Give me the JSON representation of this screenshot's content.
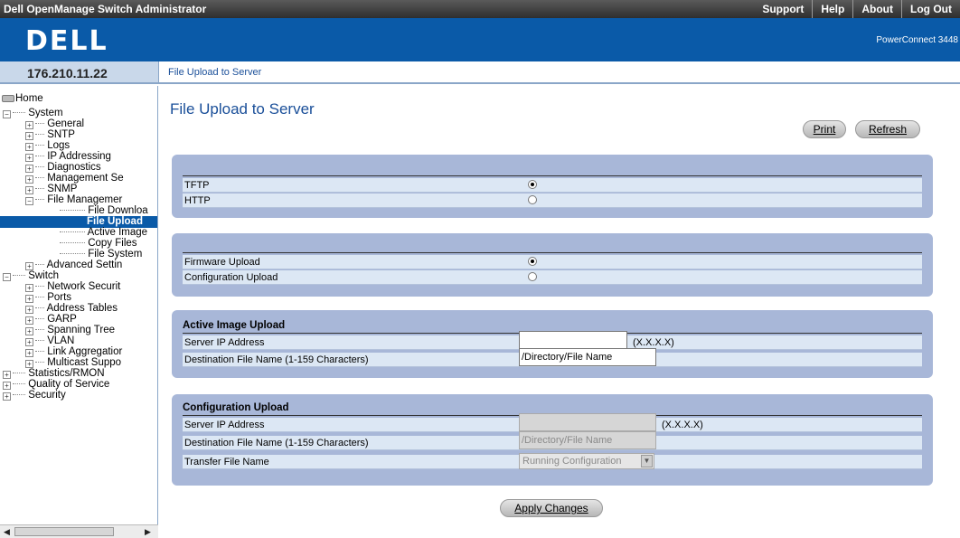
{
  "topbar": {
    "title": "Dell OpenManage Switch Administrator",
    "links": [
      "Support",
      "Help",
      "About",
      "Log Out"
    ]
  },
  "banner": {
    "logo": "DELL",
    "product": "PowerConnect 3448"
  },
  "ip_address": "176.210.11.22",
  "breadcrumb": "File Upload to Server",
  "tree": {
    "home": "Home",
    "system": "System",
    "system_items": [
      "General",
      "SNTP",
      "Logs",
      "IP Addressing",
      "Diagnostics",
      "Management Se",
      "SNMP",
      "File Managemer"
    ],
    "file_mgmt_items": [
      "File Downloa",
      "File Upload",
      "Active Image",
      "Copy Files",
      "File System"
    ],
    "advanced": "Advanced Settin",
    "switch": "Switch",
    "switch_items": [
      "Network Securit",
      "Ports",
      "Address Tables",
      "GARP",
      "Spanning Tree",
      "VLAN",
      "Link Aggregatior",
      "Multicast Suppo"
    ],
    "root_items": [
      "Statistics/RMON",
      "Quality of Service",
      "Security"
    ]
  },
  "page": {
    "title": "File Upload to Server",
    "print_label": "Print",
    "refresh_label": "Refresh",
    "protocol": {
      "options": [
        "TFTP",
        "HTTP"
      ],
      "selected": "TFTP"
    },
    "upload_type": {
      "options": [
        "Firmware Upload",
        "Configuration Upload"
      ],
      "selected": "Firmware Upload"
    },
    "active_image": {
      "title": "Active Image Upload",
      "server_ip_label": "Server IP Address",
      "server_ip_value": "",
      "ip_hint": "(X.X.X.X)",
      "dest_label": "Destination File Name (1-159 Characters)",
      "dest_value": "/Directory/File Name"
    },
    "config_upload": {
      "title": "Configuration Upload",
      "server_ip_label": "Server IP Address",
      "server_ip_value": "",
      "ip_hint": "(X.X.X.X)",
      "dest_label": "Destination File Name (1-159 Characters)",
      "dest_value": "/Directory/File Name",
      "transfer_label": "Transfer File Name",
      "transfer_value": "Running Configuration"
    },
    "apply_label": "Apply Changes"
  }
}
